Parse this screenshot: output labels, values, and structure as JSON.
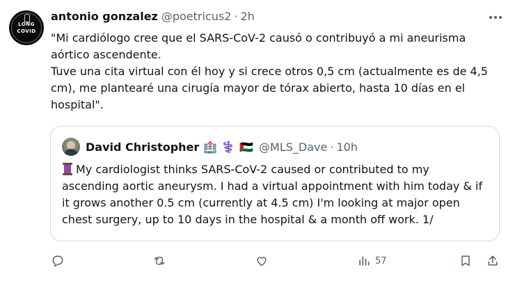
{
  "author": {
    "name": "antonio gonzalez",
    "handle": "@poetricus2",
    "separator": "·",
    "time": "2h",
    "avatar_text": [
      "LONG",
      "COVID"
    ]
  },
  "post": {
    "paragraphs": [
      "\"Mi cardiólogo cree que el SARS-CoV-2 causó o contribuyó a mi aneurisma aórtico ascendente.",
      "Tuve una cita virtual con él hoy y si crece otros 0,5 cm (actualmente es de 4,5 cm), me plantearé una cirugía mayor de tórax abierto, hasta 10 días en el hospital\"."
    ]
  },
  "quoted_post": {
    "name": "David Christopher",
    "emojis": [
      "🏥",
      "⚕️",
      "🇵🇸"
    ],
    "handle": "@MLS_Dave",
    "separator": "·",
    "time": "10h",
    "text": "My cardiologist thinks SARS-CoV-2 caused or contributed to my ascending aortic aneurysm. I had a virtual appointment with him today & if it grows another 0.5 cm (currently at 4.5 cm) I'm looking at major open chest surgery, up to 10 days in the hospital & a month off work. 1/",
    "leading_icon": "thread-spool-icon"
  },
  "actions": {
    "reply_count": "",
    "repost_count": "",
    "like_count": "",
    "views_count": "57"
  },
  "colors": {
    "text_primary": "#0f1419",
    "text_secondary": "#536471",
    "border": "#cfd9de",
    "background": "#ffffff"
  }
}
